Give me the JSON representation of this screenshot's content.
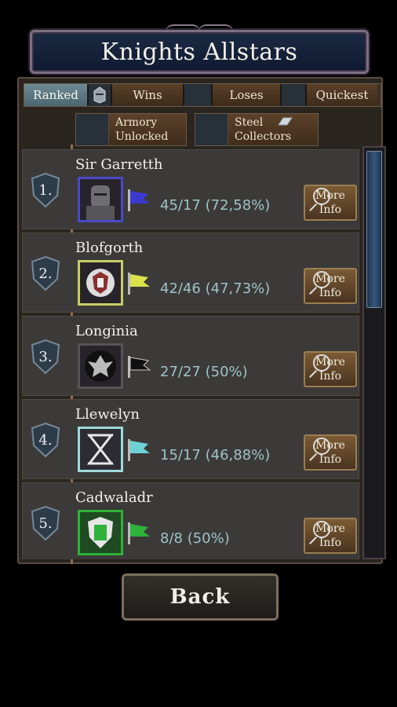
{
  "title": "Knights Allstars",
  "tabs": [
    {
      "label": "Ranked",
      "active": true
    },
    {
      "label": "Wins",
      "active": false
    },
    {
      "label": "Loses",
      "active": false
    },
    {
      "label": "Quickest",
      "active": false
    }
  ],
  "filters": [
    {
      "line1": "Armory",
      "line2": "Unlocked"
    },
    {
      "line1": "Steel",
      "line2": "Collectors"
    }
  ],
  "rows": [
    {
      "rank": "1.",
      "name": "Sir Garretth",
      "score": "45/17 (72,58%)",
      "more_line1": "More",
      "more_line2": "Info",
      "color": "#3b3ad0"
    },
    {
      "rank": "2.",
      "name": "Blofgorth",
      "score": "42/46 (47,73%)",
      "more_line1": "More",
      "more_line2": "Info",
      "color": "#d9e24a"
    },
    {
      "rank": "3.",
      "name": "Longinia",
      "score": "27/27 (50%)",
      "more_line1": "More",
      "more_line2": "Info",
      "color": "#1a1a1a"
    },
    {
      "rank": "4.",
      "name": "Llewelyn",
      "score": "15/17 (46,88%)",
      "more_line1": "More",
      "more_line2": "Info",
      "color": "#6fd2d6"
    },
    {
      "rank": "5.",
      "name": "Cadwaladr",
      "score": "8/8 (50%)",
      "more_line1": "More",
      "more_line2": "Info",
      "color": "#2fb13a"
    }
  ],
  "back_label": "Back"
}
